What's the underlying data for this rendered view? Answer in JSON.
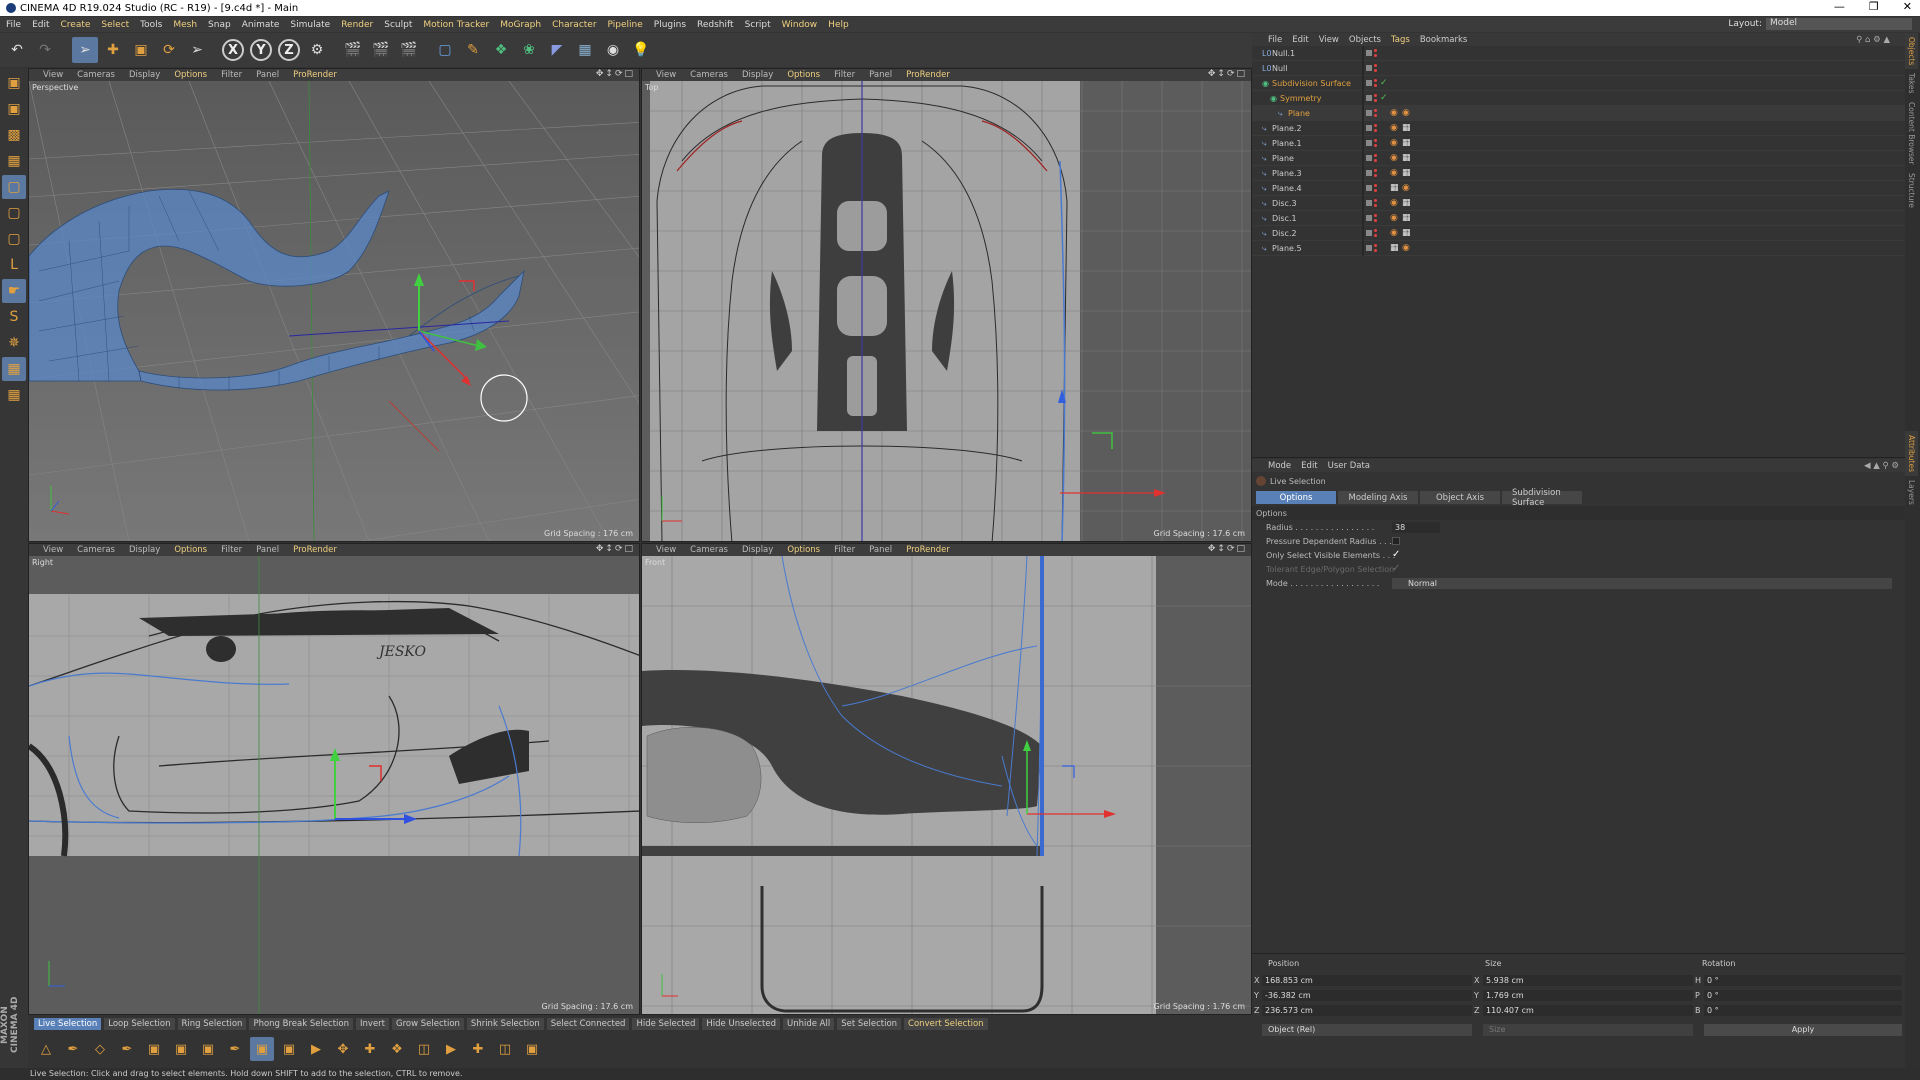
{
  "titlebar": {
    "title": "CINEMA 4D R19.024 Studio (RC - R19) - [9.c4d *] - Main"
  },
  "menu": {
    "items": [
      "File",
      "Edit",
      "Create",
      "Select",
      "Tools",
      "Mesh",
      "Snap",
      "Animate",
      "Simulate",
      "Render",
      "Sculpt",
      "Motion Tracker",
      "MoGraph",
      "Character",
      "Pipeline",
      "Plugins",
      "Redshift",
      "Script",
      "Window",
      "Help"
    ],
    "layout_label": "Layout:",
    "layout_value": "Model"
  },
  "viewports": {
    "menu": [
      "View",
      "Cameras",
      "Display",
      "Options",
      "Filter",
      "Panel",
      "ProRender"
    ],
    "perspective": {
      "label": "Perspective",
      "grid": "Grid Spacing : 176 cm"
    },
    "top": {
      "label": "Top",
      "grid": "Grid Spacing : 17.6 cm"
    },
    "right": {
      "label": "Right",
      "grid": "Grid Spacing : 17.6 cm"
    },
    "front": {
      "label": "Front",
      "grid": "Grid Spacing : 1.76 cm"
    }
  },
  "objects": {
    "menu": [
      "File",
      "Edit",
      "View",
      "Objects",
      "Tags",
      "Bookmarks"
    ],
    "rows": [
      {
        "name": "Null.1",
        "icon": "null",
        "indent": 0,
        "orange": false,
        "tags": 0
      },
      {
        "name": "Null",
        "icon": "null",
        "indent": 0,
        "orange": false,
        "tags": 0
      },
      {
        "name": "Subdivision Surface",
        "icon": "subdiv",
        "indent": 0,
        "orange": true,
        "tags": 0
      },
      {
        "name": "Symmetry",
        "icon": "symmetry",
        "indent": 1,
        "orange": true,
        "tags": 0
      },
      {
        "name": "Plane",
        "icon": "plane",
        "indent": 2,
        "orange": true,
        "tags": 2
      },
      {
        "name": "Plane.2",
        "icon": "plane",
        "indent": 0,
        "orange": false,
        "tags": 2
      },
      {
        "name": "Plane.1",
        "icon": "plane",
        "indent": 0,
        "orange": false,
        "tags": 2
      },
      {
        "name": "Plane",
        "icon": "plane",
        "indent": 0,
        "orange": false,
        "tags": 2
      },
      {
        "name": "Plane.3",
        "icon": "plane",
        "indent": 0,
        "orange": false,
        "tags": 2
      },
      {
        "name": "Plane.4",
        "icon": "plane",
        "indent": 0,
        "orange": false,
        "tags": 2
      },
      {
        "name": "Disc.3",
        "icon": "disc",
        "indent": 0,
        "orange": false,
        "tags": 2
      },
      {
        "name": "Disc.1",
        "icon": "disc",
        "indent": 0,
        "orange": false,
        "tags": 2
      },
      {
        "name": "Disc.2",
        "icon": "disc",
        "indent": 0,
        "orange": false,
        "tags": 2
      },
      {
        "name": "Plane.5",
        "icon": "plane",
        "indent": 0,
        "orange": false,
        "tags": 2
      }
    ]
  },
  "attributes": {
    "menu": [
      "Mode",
      "Edit",
      "User Data"
    ],
    "tool_name": "Live Selection",
    "tabs": [
      "Options",
      "Modeling Axis",
      "Object Axis",
      "Subdivision Surface"
    ],
    "section": "Options",
    "radius_label": "Radius . . . . . . . . . . . . . . . .",
    "radius_value": "38",
    "pressure_label": "Pressure Dependent Radius . . .",
    "only_visible_label": "Only Select Visible Elements . . .",
    "tolerant_label": "Tolerant Edge/Polygon Selection",
    "mode_label": "Mode . . . . . . . . . . . . . . . . . .",
    "mode_value": "Normal"
  },
  "coords": {
    "headers": [
      "Position",
      "Size",
      "Rotation"
    ],
    "rows": [
      {
        "axis": "X",
        "pos": "168.853 cm",
        "size_axis": "X",
        "size": "5.938 cm",
        "rot_axis": "H",
        "rot": "0 °"
      },
      {
        "axis": "Y",
        "pos": "-36.382 cm",
        "size_axis": "Y",
        "size": "1.769 cm",
        "rot_axis": "P",
        "rot": "0 °"
      },
      {
        "axis": "Z",
        "pos": "236.573 cm",
        "size_axis": "Z",
        "size": "110.407 cm",
        "rot_axis": "B",
        "rot": "0 °"
      }
    ],
    "mode": "Object (Rel)",
    "size_mode": "Size",
    "apply": "Apply"
  },
  "bottom_buttons": [
    "Live Selection",
    "Loop Selection",
    "Ring Selection",
    "Phong Break Selection",
    "Invert",
    "Grow Selection",
    "Shrink Selection",
    "Select Connected",
    "Hide Selected",
    "Hide Unselected",
    "Unhide All",
    "Set Selection",
    "Convert Selection"
  ],
  "status": "Live Selection: Click and drag to select elements. Hold down SHIFT to add to the selection, CTRL to remove.",
  "side_tabs": [
    "Objects",
    "Takes",
    "Content Browser",
    "Structure"
  ],
  "side_tabs2": [
    "Attributes",
    "Layers"
  ],
  "brand": "MAXON CINEMA 4D",
  "colors": {
    "accent": "#5a80b8",
    "highlight": "#f0d080",
    "mesh": "#6a9ad8"
  }
}
